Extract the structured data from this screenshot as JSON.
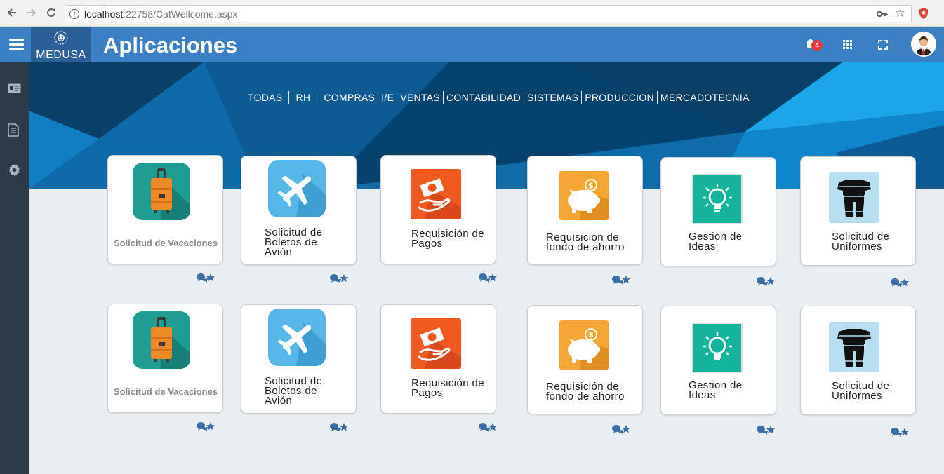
{
  "browser": {
    "url_host": "localhost",
    "url_rest": ":22758/CatWellcome.aspx",
    "icons": [
      "back-icon",
      "forward-icon",
      "reload-icon",
      "info-icon",
      "key-icon",
      "star-icon",
      "shield-icon"
    ]
  },
  "header": {
    "logo_text": "MEDUSA",
    "title": "Aplicaciones",
    "notification_count": "4",
    "icons": [
      "menu-icon",
      "bell-icon",
      "apps-grid-icon",
      "fullscreen-icon",
      "avatar"
    ]
  },
  "sidebar": {
    "icons": [
      "id-card-icon",
      "document-icon",
      "gear-icon"
    ]
  },
  "filters": [
    "TODAS",
    "RH",
    "COMPRAS",
    "I/E",
    "VENTAS",
    "CONTABILIDAD",
    "SISTEMAS",
    "PRODUCCION",
    "MERCADOTECNIA"
  ],
  "apps": [
    {
      "label": "Solicitud de Vacaciones",
      "icon": "suitcase-icon"
    },
    {
      "label": "Solicitud de\nBoletos de\nAvión",
      "icon": "airplane-icon"
    },
    {
      "label": "Requisición de\nPagos",
      "icon": "payment-hand-icon"
    },
    {
      "label": "Requisición de\nfondo de ahorro",
      "icon": "piggy-bank-icon"
    },
    {
      "label": "Gestion de\nIdeas",
      "icon": "lightbulb-icon"
    },
    {
      "label": "Solicitud de\nUniformes",
      "icon": "uniform-icon"
    }
  ],
  "colors": {
    "header": "#3b7fc4",
    "logo_bg": "#2a5f97",
    "sidebar": "#2d3a4a",
    "banner_dark": "#0a4a77",
    "banner_light": "#1aa6e8",
    "action_icons": "#3a6fa5"
  }
}
